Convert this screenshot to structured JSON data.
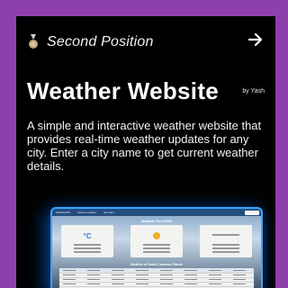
{
  "card": {
    "badge_text": "Second Position",
    "title": "Weather Website",
    "author": "by Yash",
    "description": "A simple and interactive weather website that provides real-time weather updates for any city. Enter a city name to get current weather details."
  },
  "preview": {
    "nav_items": [
      "WeatherWiz",
      "Select Location",
      "Nav Item"
    ],
    "heading": "Weather For Delhi",
    "temp_unit": "°C",
    "subheading": "Weather of Some Common Places"
  },
  "icons": {
    "badge": "medal-icon",
    "arrow": "arrow-right-icon"
  },
  "colors": {
    "background": "#8e3fae",
    "card": "#000000",
    "glow": "#1f7bff",
    "accent_blue": "#3aa5ff"
  }
}
